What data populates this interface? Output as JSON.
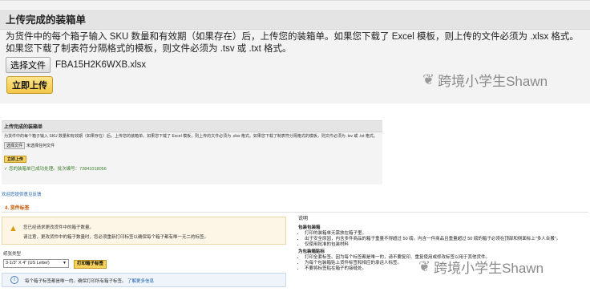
{
  "upload_panel": {
    "title": "上传完成的装箱单",
    "description": "为货件中的每个箱子输入 SKU 数量和有效期（如果存在）后，上传您的装箱单。如果您下载了 Excel 模板，则上传的文件必须为 .xlsx 格式。如果您下载了制表符分隔格式的模板，则文件必须为 .tsv 或 .txt 格式。",
    "choose_file_label": "选择文件",
    "file_name": "FBA15H2K6WXB.xlsx",
    "upload_button": "立即上传"
  },
  "watermark": {
    "text": "跨境小学生Shawn",
    "icon": "wechat-icon"
  },
  "small_panel": {
    "title": "上传完成的装箱单",
    "description": "为货件中的每个箱子输入 SKU 数量和有效期（如果存在）后，上传您的装箱单。如果您下载了 Excel 模板，则上传的文件必须为 .xlsx 格式。如果您下载了制表符分隔格式的模板，则文件必须为 .tsv 或 .txt 格式。",
    "choose_file_label": "选择文件",
    "no_file_text": "未选择任何文件",
    "upload_button": "立即上传",
    "success_text": "✓ 您的装箱单已成功处理。批次编号：72841018056"
  },
  "feedback_link": "欢迎您提供意见反馈",
  "step4": {
    "title": "4. 货件标签",
    "warning_line1": "您已经请求更改货件中的箱子数量。",
    "warning_line2": "请注意，更改货件中的箱子数量时，您必须重新打印标签以确保每个箱子都有唯一无二的标签。",
    "paper_type_label": "纸张类型",
    "paper_type_value": "3-1/3\" X 4\" (US Letter)",
    "print_button": "打印箱子标签",
    "info_text": "每个箱子标签都是唯一的。确保打印所有箱子标签。",
    "info_link": "了解更多信息"
  },
  "instructions": {
    "heading": "说明",
    "section1_title": "包装包装箱",
    "section1_items": [
      "打印的装箱单无需放在箱子里。",
      "出于安全原因，内含多件商品的箱子重量不得超过 50 磅。内含一件商品且重量超过 50 磅的箱子必须在顶部和侧面标上\"多人合搬\"。",
      "仅使用批准的包装材料"
    ],
    "section2_title": "为包装箱贴标",
    "section2_items": [
      "打印全套标签。因为每个标签都是唯一的，请不要复印、重复使用或修改标签以用于其他货件。",
      "为每个包装箱贴上货件标签和相应的承运人标签。",
      "不要将标签贴在箱子的接缝处。"
    ]
  },
  "colors": {
    "accent_button": "#f2c649",
    "success": "#3a7d2a",
    "link": "#1a5fa8",
    "step_title": "#c45500"
  }
}
